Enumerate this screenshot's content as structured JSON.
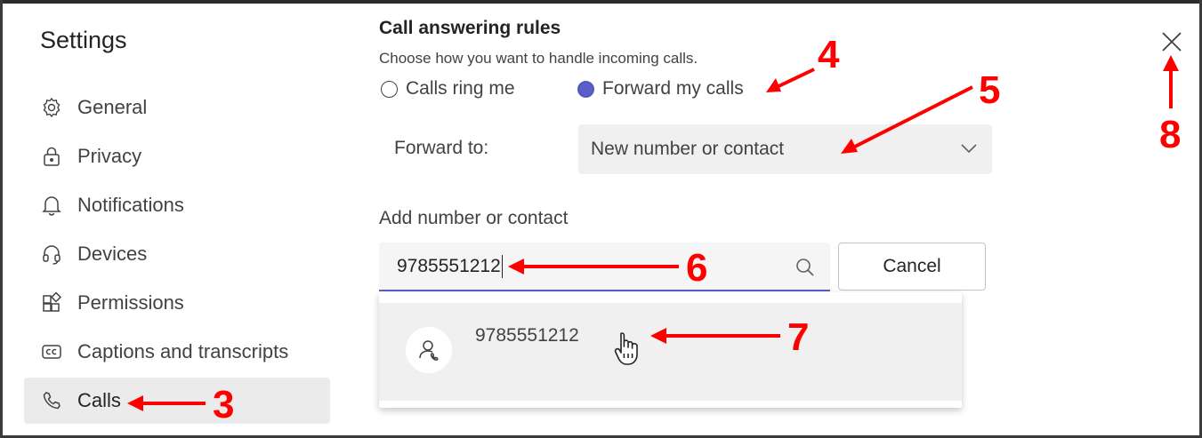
{
  "settings": {
    "title": "Settings",
    "nav": [
      {
        "label": "General",
        "icon": "gear-icon"
      },
      {
        "label": "Privacy",
        "icon": "lock-icon"
      },
      {
        "label": "Notifications",
        "icon": "bell-icon"
      },
      {
        "label": "Devices",
        "icon": "headset-icon"
      },
      {
        "label": "Permissions",
        "icon": "permissions-icon"
      },
      {
        "label": "Captions and transcripts",
        "icon": "cc-icon"
      },
      {
        "label": "Calls",
        "icon": "phone-icon",
        "active": true
      }
    ]
  },
  "call_rules": {
    "title": "Call answering rules",
    "subtitle": "Choose how you want to handle incoming calls.",
    "options": [
      {
        "label": "Calls ring me",
        "selected": false
      },
      {
        "label": "Forward my calls",
        "selected": true
      }
    ],
    "forward_label": "Forward to:",
    "forward_value": "New number or contact",
    "add_label": "Add number or contact",
    "search_value": "9785551212",
    "cancel_label": "Cancel",
    "suggestion": "9785551212"
  },
  "annotations": {
    "n3": "3",
    "n4": "4",
    "n5": "5",
    "n6": "6",
    "n7": "7",
    "n8": "8"
  },
  "colors": {
    "accent": "#5b5fc7",
    "annotation": "#ff0000",
    "selected_nav_bg": "#ebebeb"
  }
}
